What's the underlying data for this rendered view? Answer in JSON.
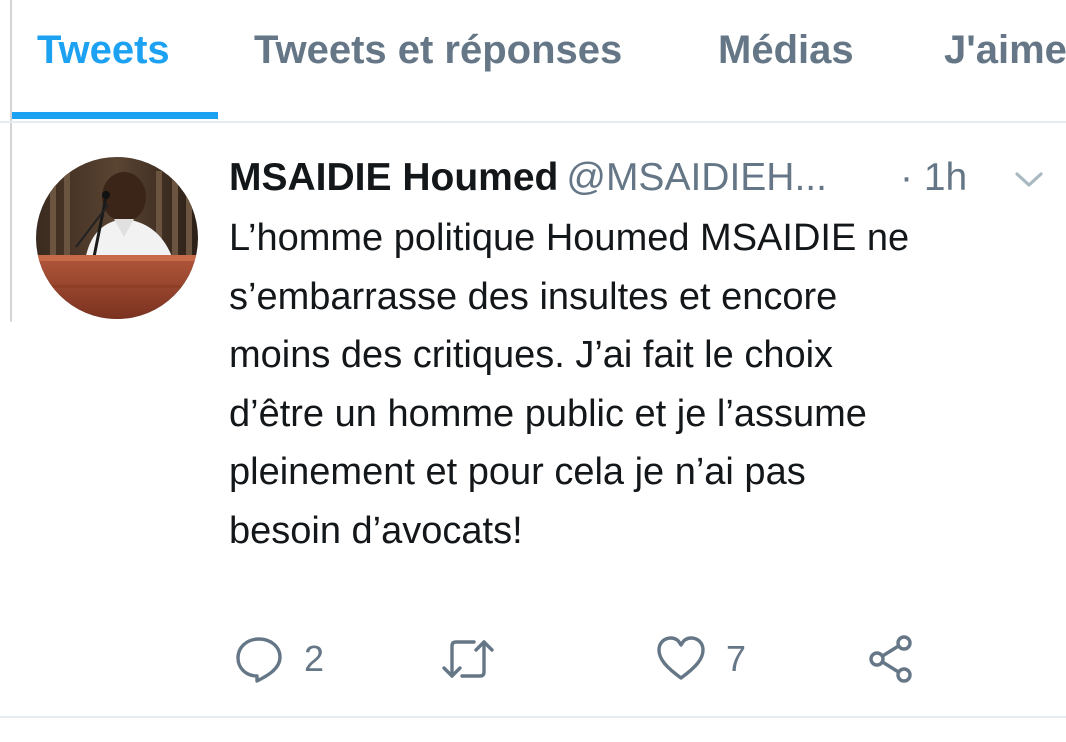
{
  "tabs": [
    {
      "label": "Tweets",
      "active": true
    },
    {
      "label": "Tweets et réponses",
      "active": false
    },
    {
      "label": "Médias",
      "active": false
    },
    {
      "label": "J'aime",
      "active": false
    }
  ],
  "tweet": {
    "display_name": "MSAIDIE Houmed",
    "handle": "@MSAIDIEH...",
    "time": "· 1h",
    "text_lines": [
      "L’homme politique Houmed MSAIDIE ne",
      "s’embarrasse des insultes et encore",
      "moins des critiques. J’ai fait le choix",
      "d’être un homme public et je l’assume",
      "pleinement et pour cela je n’ai pas",
      "besoin d’avocats!"
    ],
    "actions": {
      "reply_count": "2",
      "retweet_count": "",
      "like_count": "7"
    }
  },
  "icons": {
    "reply": "reply-icon",
    "retweet": "retweet-icon",
    "like": "heart-icon",
    "share": "share-icon",
    "menu": "chevron-down-icon"
  },
  "colors": {
    "accent": "#1da1f2",
    "secondary_text": "#657786",
    "primary_text": "#14171a",
    "border": "#e6ecf0"
  }
}
